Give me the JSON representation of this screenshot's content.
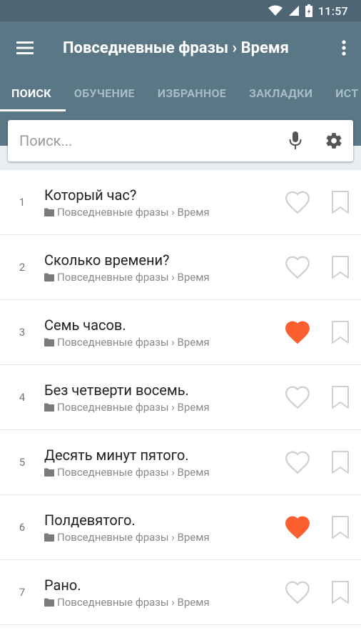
{
  "status_bar": {
    "time": "11:57"
  },
  "app_bar": {
    "title": "Повседневные фразы › Время"
  },
  "tabs": [
    {
      "label": "ПОИСК",
      "active": true
    },
    {
      "label": "ОБУЧЕНИЕ",
      "active": false
    },
    {
      "label": "ИЗБРАННОЕ",
      "active": false
    },
    {
      "label": "ЗАКЛАДКИ",
      "active": false
    },
    {
      "label": "ИСТ",
      "active": false
    }
  ],
  "search": {
    "placeholder": "Поиск..."
  },
  "phrases": [
    {
      "num": "1",
      "text": "Который час?",
      "path": "Повседневные фразы › Время",
      "favorite": false
    },
    {
      "num": "2",
      "text": "Сколько времени?",
      "path": "Повседневные фразы › Время",
      "favorite": false
    },
    {
      "num": "3",
      "text": "Семь часов.",
      "path": "Повседневные фразы › Время",
      "favorite": true
    },
    {
      "num": "4",
      "text": "Без четверти восемь.",
      "path": "Повседневные фразы › Время",
      "favorite": false
    },
    {
      "num": "5",
      "text": "Десять минут пятого.",
      "path": "Повседневные фразы › Время",
      "favorite": false
    },
    {
      "num": "6",
      "text": "Полдевятого.",
      "path": "Повседневные фразы › Время",
      "favorite": true
    },
    {
      "num": "7",
      "text": "Рано.",
      "path": "Повседневные фразы › Время",
      "favorite": false
    }
  ],
  "colors": {
    "primary": "#5a7786",
    "status_bar": "#4e6573",
    "heart_active": "#fb5e2f",
    "icon_inactive": "#cfcfcf"
  }
}
